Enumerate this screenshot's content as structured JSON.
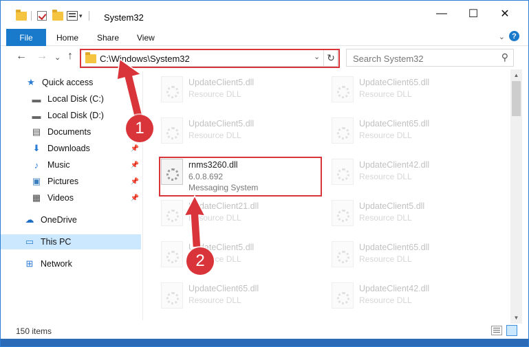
{
  "window": {
    "title": "System32",
    "minimize_glyph": "—",
    "maximize_glyph": "☐",
    "close_glyph": "✕"
  },
  "ribbon": {
    "file": "File",
    "tabs": [
      "Home",
      "Share",
      "View"
    ],
    "expand_glyph": "⌄",
    "help_glyph": "?"
  },
  "nav": {
    "back_glyph": "←",
    "forward_glyph": "→",
    "recent_glyph": "⌄",
    "up_glyph": "↑",
    "address": "C:\\Windows\\System32",
    "address_dropdown_glyph": "⌄",
    "refresh_glyph": "↻",
    "search_placeholder": "Search System32",
    "search_glyph": "⚲"
  },
  "sidebar": {
    "items": [
      {
        "label": "Quick access",
        "icon": "star-icon",
        "glyph": "★",
        "color": "#2b7cd3"
      },
      {
        "label": "Local Disk (C:)",
        "icon": "drive-icon",
        "glyph": "▬",
        "color": "#666666"
      },
      {
        "label": "Local Disk (D:)",
        "icon": "drive-icon",
        "glyph": "▬",
        "color": "#666666"
      },
      {
        "label": "Documents",
        "icon": "document-icon",
        "glyph": "▤",
        "color": "#555555"
      },
      {
        "label": "Downloads",
        "icon": "download-icon",
        "glyph": "⬇",
        "color": "#2b7cd3"
      },
      {
        "label": "Music",
        "icon": "music-icon",
        "glyph": "♪",
        "color": "#2b7cd3"
      },
      {
        "label": "Pictures",
        "icon": "pictures-icon",
        "glyph": "▣",
        "color": "#3b7fbf"
      },
      {
        "label": "Videos",
        "icon": "videos-icon",
        "glyph": "▦",
        "color": "#444444"
      },
      {
        "label": "OneDrive",
        "icon": "cloud-icon",
        "glyph": "☁",
        "color": "#1e6fc4"
      },
      {
        "label": "This PC",
        "icon": "computer-icon",
        "glyph": "▭",
        "color": "#2b7cd3"
      },
      {
        "label": "Network",
        "icon": "network-icon",
        "glyph": "⊞",
        "color": "#2b7cd3"
      }
    ],
    "pin_glyph": "📌"
  },
  "files": {
    "left": [
      {
        "name": "UpdateClient5.dll",
        "type": "Resource DLL"
      },
      {
        "name": "UpdateClient5.dll",
        "type": "Resource DLL"
      },
      {
        "name": "rnms3260.dll",
        "version": "6.0.8.692",
        "description": "Messaging System"
      },
      {
        "name": "UpdateClient21.dll",
        "type": "Resource DLL"
      },
      {
        "name": "UpdateClient5.dll",
        "type": "Resource DLL"
      },
      {
        "name": "UpdateClient65.dll",
        "type": "Resource DLL"
      }
    ],
    "right": [
      {
        "name": "UpdateClient65.dll",
        "type": "Resource DLL"
      },
      {
        "name": "UpdateClient65.dll",
        "type": "Resource DLL"
      },
      {
        "name": "UpdateClient42.dll",
        "type": "Resource DLL"
      },
      {
        "name": "UpdateClient5.dll",
        "type": "Resource DLL"
      },
      {
        "name": "UpdateClient65.dll",
        "type": "Resource DLL"
      },
      {
        "name": "UpdateClient42.dll",
        "type": "Resource DLL"
      }
    ]
  },
  "scrollbar": {
    "up_glyph": "▲",
    "down_glyph": "▼",
    "position": 0.0
  },
  "status": {
    "count": "150 items"
  },
  "callouts": {
    "one": "1",
    "two": "2"
  },
  "colors": {
    "accent": "#1979ca",
    "highlight": "#d9343a",
    "selection": "#cce8ff"
  }
}
